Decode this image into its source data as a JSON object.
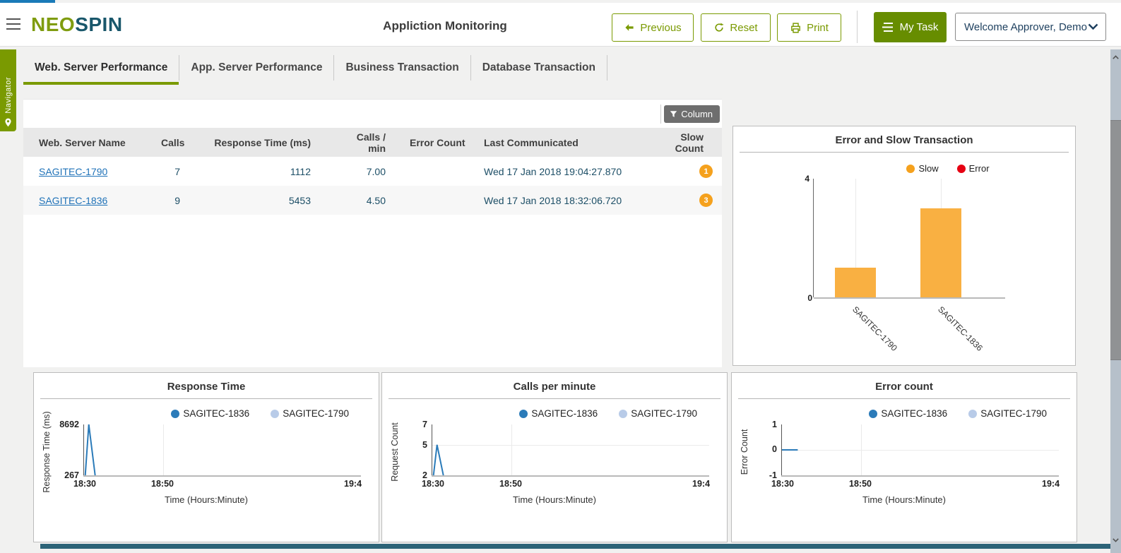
{
  "header": {
    "title": "Appliction Monitoring",
    "logo": {
      "part1": "NEO",
      "part2": "SPIN"
    },
    "buttons": {
      "previous": "Previous",
      "reset": "Reset",
      "print": "Print",
      "my_task": "My Task"
    },
    "user_menu": "Welcome Approver, Demo"
  },
  "navigator": {
    "label": "Navigator"
  },
  "tabs": [
    {
      "label": "Web. Server Performance",
      "active": true
    },
    {
      "label": "App. Server Performance",
      "active": false
    },
    {
      "label": "Business Transaction",
      "active": false
    },
    {
      "label": "Database Transaction",
      "active": false
    }
  ],
  "table": {
    "column_button": "Column",
    "headers": [
      "Web. Server Name",
      "Calls",
      "Response Time (ms)",
      "Calls / min",
      "Error Count",
      "Last Communicated",
      "Slow Count"
    ],
    "rows": [
      {
        "name": "SAGITEC-1790",
        "calls": "7",
        "response_time": "1112",
        "calls_per_min": "7.00",
        "error_count": "",
        "last_communicated": "Wed 17 Jan 2018 19:04:27.870",
        "slow_count": "1"
      },
      {
        "name": "SAGITEC-1836",
        "calls": "9",
        "response_time": "5453",
        "calls_per_min": "4.50",
        "error_count": "",
        "last_communicated": "Wed 17 Jan 2018 18:32:06.720",
        "slow_count": "3"
      }
    ]
  },
  "chart_data": [
    {
      "type": "bar",
      "title": "Error and Slow Transaction",
      "categories": [
        "SAGITEC-1790",
        "SAGITEC-1836"
      ],
      "series": [
        {
          "name": "Slow",
          "color": "#f9b042",
          "legend_color": "#f5a11d",
          "values": [
            1,
            3
          ]
        },
        {
          "name": "Error",
          "color": "#e60012",
          "legend_color": "#e60012",
          "values": [
            0,
            0
          ]
        }
      ],
      "ylim": [
        0,
        4
      ],
      "yticks": [
        "4",
        "0"
      ],
      "legend_position": "top-right",
      "grid": "vertical-category-lines"
    },
    {
      "type": "line",
      "title": "Response Time",
      "xlabel": "Time (Hours:Minute)",
      "ylabel": "Response Time (ms)",
      "yticks": [
        "8692",
        "267"
      ],
      "xticks": [
        "18:30",
        "18:50",
        "19:4"
      ],
      "ylim": [
        267,
        8692
      ],
      "x_range_minutes": [
        0,
        70
      ],
      "series": [
        {
          "name": "SAGITEC-1836",
          "color": "#2b7bb9",
          "points": [
            [
              0.3,
              267
            ],
            [
              1.2,
              8692
            ],
            [
              2.8,
              267
            ]
          ]
        },
        {
          "name": "SAGITEC-1790",
          "color": "#b8cbe8",
          "points": []
        }
      ]
    },
    {
      "type": "line",
      "title": "Calls per minute",
      "xlabel": "Time (Hours:Minute)",
      "ylabel": "Request Count",
      "yticks": [
        "7",
        "5",
        "2"
      ],
      "xticks": [
        "18:30",
        "18:50",
        "19:4"
      ],
      "ylim": [
        2,
        7
      ],
      "gridline_y": 5,
      "x_range_minutes": [
        0,
        70
      ],
      "series": [
        {
          "name": "SAGITEC-1836",
          "color": "#2b7bb9",
          "points": [
            [
              0.3,
              2
            ],
            [
              1.2,
              5
            ],
            [
              2.8,
              2
            ]
          ]
        },
        {
          "name": "SAGITEC-1790",
          "color": "#b8cbe8",
          "points": []
        }
      ]
    },
    {
      "type": "line",
      "title": "Error count",
      "xlabel": "Time (Hours:Minute)",
      "ylabel": "Error Count",
      "yticks": [
        "1",
        "0",
        "-1"
      ],
      "xticks": [
        "18:30",
        "18:50",
        "19:4"
      ],
      "ylim": [
        -1,
        1
      ],
      "gridline_y": 0,
      "x_range_minutes": [
        0,
        70
      ],
      "series": [
        {
          "name": "SAGITEC-1836",
          "color": "#2b7bb9",
          "points": [
            [
              0,
              0
            ],
            [
              4,
              0
            ]
          ]
        },
        {
          "name": "SAGITEC-1790",
          "color": "#b8cbe8",
          "points": []
        }
      ]
    }
  ],
  "colors": {
    "accent_green": "#7a9a01",
    "brand_teal": "#19576b",
    "badge_orange": "#f5a11d",
    "link_blue": "#1f72b8",
    "bottom_bar": "#2d6478"
  }
}
